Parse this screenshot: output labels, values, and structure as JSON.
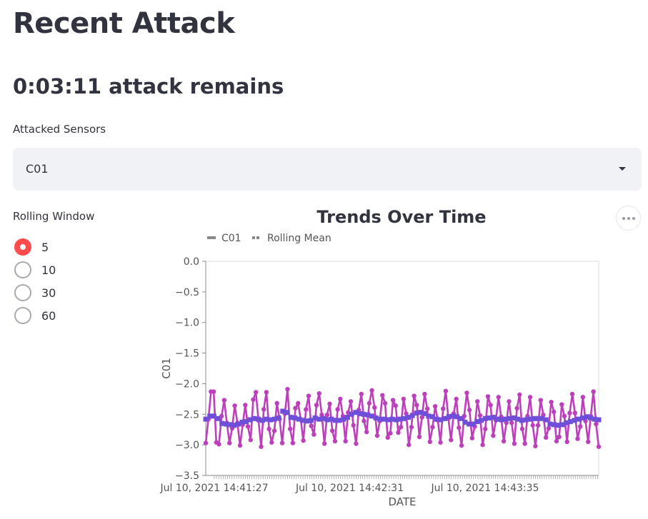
{
  "page": {
    "title": "Recent Attack",
    "timer_text": "0:03:11 attack remains"
  },
  "sensor_select": {
    "label": "Attacked Sensors",
    "value": "C01"
  },
  "rolling_window": {
    "label": "Rolling Window",
    "options": [
      "5",
      "10",
      "30",
      "60"
    ],
    "selected": "5"
  },
  "colors": {
    "accent": "#ff4b4b",
    "series_c01": "#bc3fbc",
    "series_mean": "#6f4fd9"
  },
  "icons": {
    "menu": "ellipsis-icon",
    "dropdown": "caret-down-icon"
  },
  "chart_data": {
    "type": "line",
    "title": "Trends Over Time",
    "xlabel": "DATE",
    "ylabel": "C01",
    "ylim": [
      -3.5,
      0.0
    ],
    "y_ticks": [
      0.0,
      -0.5,
      -1.0,
      -1.5,
      -2.0,
      -2.5,
      -3.0,
      -3.5
    ],
    "y_tick_labels": [
      "0.0",
      "−0.5",
      "−1.0",
      "−1.5",
      "−2.0",
      "−2.5",
      "−3.0",
      "−3.5"
    ],
    "x_tick_labels": [
      "Jul 10, 2021 14:41:27",
      "Jul 10, 2021 14:42:31",
      "Jul 10, 2021 14:43:35"
    ],
    "x_range_seconds_approx": [
      0,
      172
    ],
    "legend": {
      "position": "top-left"
    },
    "grid": false,
    "series": [
      {
        "name": "C01",
        "values": [
          -2.97,
          -2.58,
          -2.13,
          -2.13,
          -2.96,
          -2.99,
          -2.53,
          -2.27,
          -2.64,
          -2.97,
          -2.73,
          -2.36,
          -2.64,
          -3.01,
          -2.67,
          -2.35,
          -2.7,
          -2.92,
          -2.26,
          -2.14,
          -2.6,
          -3.03,
          -2.42,
          -2.14,
          -2.74,
          -2.96,
          -2.77,
          -2.32,
          -2.58,
          -2.97,
          -2.49,
          -2.09,
          -2.74,
          -2.97,
          -2.4,
          -2.32,
          -2.58,
          -2.93,
          -2.42,
          -2.2,
          -2.69,
          -2.83,
          -2.35,
          -2.16,
          -2.51,
          -2.98,
          -2.51,
          -2.33,
          -2.77,
          -2.94,
          -2.42,
          -2.25,
          -2.53,
          -2.94,
          -2.47,
          -2.29,
          -2.68,
          -2.98,
          -2.43,
          -2.17,
          -2.61,
          -2.79,
          -2.32,
          -2.11,
          -2.39,
          -2.85,
          -2.61,
          -2.19,
          -2.32,
          -2.88,
          -2.81,
          -2.27,
          -2.36,
          -2.8,
          -2.71,
          -2.25,
          -2.49,
          -3.0,
          -2.71,
          -2.2,
          -2.35,
          -2.87,
          -2.55,
          -2.17,
          -2.41,
          -2.95,
          -2.71,
          -2.37,
          -2.6,
          -2.96,
          -2.41,
          -2.12,
          -2.57,
          -2.92,
          -2.49,
          -2.25,
          -2.72,
          -3.01,
          -2.53,
          -2.15,
          -2.43,
          -2.89,
          -2.7,
          -2.29,
          -2.52,
          -3.0,
          -2.74,
          -2.21,
          -2.35,
          -2.85,
          -2.6,
          -2.22,
          -2.54,
          -2.94,
          -2.64,
          -2.29,
          -2.64,
          -2.98,
          -2.4,
          -2.18,
          -2.74,
          -2.98,
          -2.53,
          -2.22,
          -2.68,
          -3.02,
          -2.68,
          -2.27,
          -2.51,
          -2.88,
          -2.73,
          -2.3,
          -2.46,
          -2.94,
          -2.87,
          -2.34,
          -2.53,
          -2.95,
          -2.48,
          -2.17,
          -2.48,
          -2.9,
          -2.7,
          -2.22,
          -2.61,
          -2.95,
          -2.53,
          -2.13,
          -2.66,
          -3.03
        ]
      },
      {
        "name": "Rolling Mean",
        "values": [
          -2.58,
          -2.53,
          -2.53,
          -2.57,
          -2.65,
          -2.66,
          -2.67,
          -2.68,
          -2.66,
          -2.63,
          -2.62,
          -2.59,
          -2.57,
          -2.58,
          -2.6,
          -2.58,
          -2.59,
          -2.58,
          -2.56,
          -2.45,
          -2.47,
          -2.55,
          -2.56,
          -2.58,
          -2.6,
          -2.61,
          -2.6,
          -2.56,
          -2.58,
          -2.57,
          -2.59,
          -2.58,
          -2.6,
          -2.6,
          -2.58,
          -2.55,
          -2.5,
          -2.47,
          -2.49,
          -2.5,
          -2.51,
          -2.53,
          -2.56,
          -2.58,
          -2.58,
          -2.59,
          -2.58,
          -2.59,
          -2.58,
          -2.57,
          -2.55,
          -2.52,
          -2.48,
          -2.47,
          -2.49,
          -2.53,
          -2.54,
          -2.58,
          -2.59,
          -2.57,
          -2.54,
          -2.53,
          -2.54,
          -2.57,
          -2.63,
          -2.66,
          -2.66,
          -2.62,
          -2.6,
          -2.57,
          -2.56,
          -2.55,
          -2.58,
          -2.59,
          -2.58,
          -2.57,
          -2.56,
          -2.58,
          -2.6,
          -2.59,
          -2.58,
          -2.57,
          -2.57,
          -2.57,
          -2.59,
          -2.66,
          -2.67,
          -2.68,
          -2.67,
          -2.64,
          -2.62,
          -2.6,
          -2.58,
          -2.56,
          -2.54,
          -2.56,
          -2.58,
          -2.59
        ]
      }
    ]
  }
}
